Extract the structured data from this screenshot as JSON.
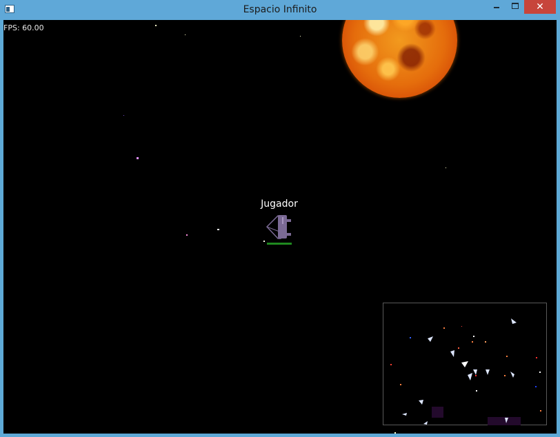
{
  "window": {
    "title": "Espacio Infinito",
    "minimize_label": "",
    "maximize_label": "",
    "close_label": "✕"
  },
  "hud": {
    "fps_text": "FPS: 60.00"
  },
  "player": {
    "name": "Jugador",
    "health_fraction": 1.0
  },
  "icons": {
    "app": "app-icon",
    "minimize": "minimize-icon",
    "maximize": "maximize-icon",
    "close": "close-icon"
  },
  "colors": {
    "space": "#000000",
    "health": "#1f8a1f",
    "ship": "#7b6a95"
  }
}
